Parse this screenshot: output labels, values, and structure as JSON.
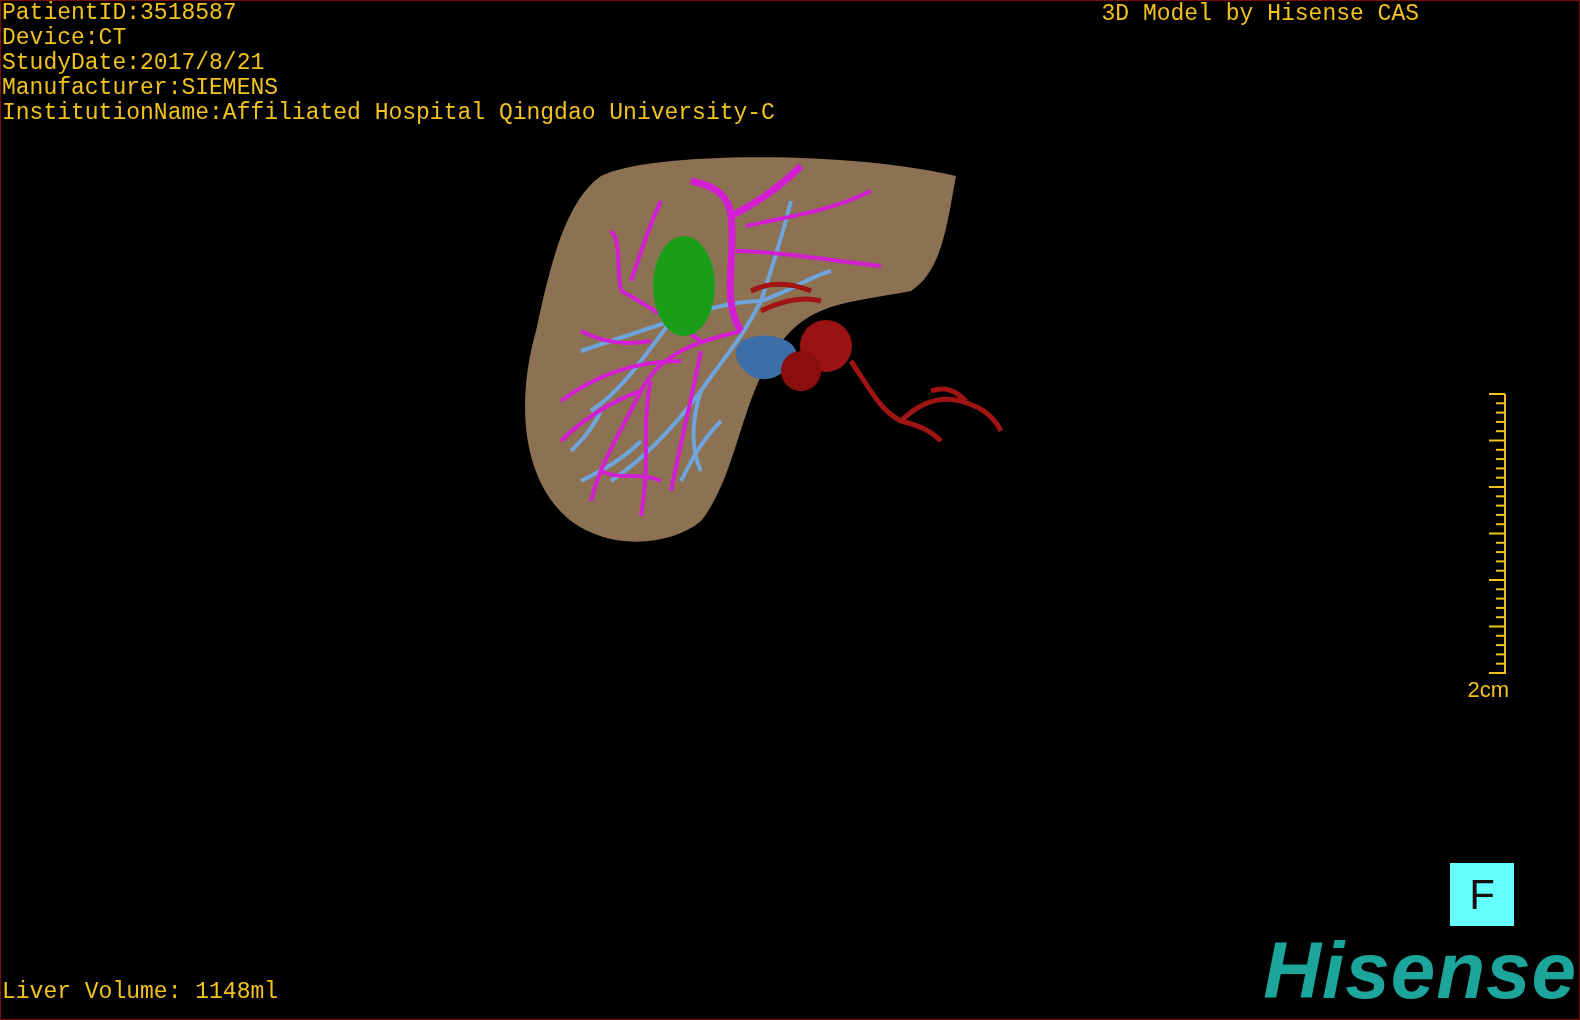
{
  "study_info": [
    "PatientID:3518587",
    "Device:CT",
    "StudyDate:2017/8/21",
    "Manufacturer:SIEMENS",
    "InstitutionName:Affiliated Hospital Qingdao University-C"
  ],
  "header_caption": "3D Model by Hisense CAS",
  "scale_bar": {
    "label": "2cm"
  },
  "orientation_marker": {
    "label": "F"
  },
  "logo": {
    "text": "Hisense"
  },
  "liver_volume": "Liver Volume: 1148ml"
}
